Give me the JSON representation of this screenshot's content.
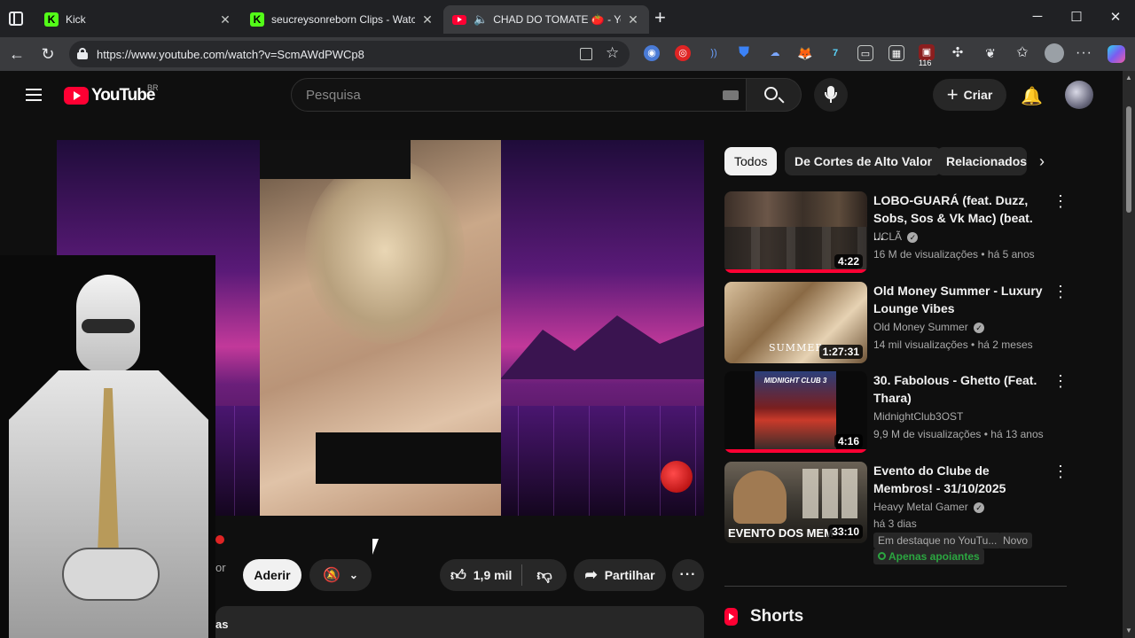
{
  "browser": {
    "tabs": [
      {
        "title": "Kick",
        "favicon_color": "#53fc18",
        "favicon_letter": "K",
        "active": false
      },
      {
        "title": "seucreysonreborn Clips - Watch L",
        "favicon_color": "#53fc18",
        "favicon_letter": "K",
        "active": false
      },
      {
        "title": "CHAD DO TOMATE 🍅 - You",
        "favicon_color": "#ff0033",
        "favicon_letter": "",
        "active": true
      }
    ],
    "new_tab": "+",
    "url": "https://www.youtube.com/watch?v=ScmAWdPWCp8",
    "extension_badge": "116"
  },
  "youtube": {
    "logo_text": "YouTube",
    "region": "BR",
    "search_placeholder": "Pesquisa",
    "create_label": "Criar"
  },
  "video": {
    "join_label": "Aderir",
    "like_count": "1,9 mil",
    "share_label": "Partilhar",
    "partial_channel_text": "or",
    "partial_desc_text": "as"
  },
  "chips": [
    {
      "label": "Todos",
      "active": true
    },
    {
      "label": "De Cortes de Alto Valor",
      "active": false
    },
    {
      "label": "Relacionados",
      "active": false
    }
  ],
  "recommendations": [
    {
      "title": "LOBO-GUARÁ (feat. Duzz, Sobs, Sos & Vk Mac) (beat. ...",
      "channel": "UCLÃ",
      "verified": true,
      "meta": "16 M de visualizações • há 5 anos",
      "duration": "4:22",
      "progress": 1.0
    },
    {
      "title": "Old Money Summer - Luxury Lounge Vibes",
      "channel": "Old Money Summer",
      "verified": true,
      "meta": "14 mil visualizações • há 2 meses",
      "duration": "1:27:31",
      "progress": 0
    },
    {
      "title": "30. Fabolous - Ghetto (Feat. Thara)",
      "channel": "MidnightClub3OST",
      "verified": false,
      "meta": "9,9 M de visualizações • há 13 anos",
      "duration": "4:16",
      "progress": 1.0
    },
    {
      "title": "Evento do Clube de Membros! - 31/10/2025",
      "channel": "Heavy Metal Gamer",
      "verified": true,
      "meta": "há 3 dias",
      "duration": "33:10",
      "progress": 0,
      "badges": [
        "Em destaque no YouTu...",
        "Novo"
      ],
      "members_only": "Apenas apoiantes",
      "thumb_text": "EVENTO DOS MEM"
    }
  ],
  "shorts_label": "Shorts",
  "thumb_texts": {
    "rec2": "SUMMER",
    "rec3": "MIDNIGHT CLUB 3"
  }
}
